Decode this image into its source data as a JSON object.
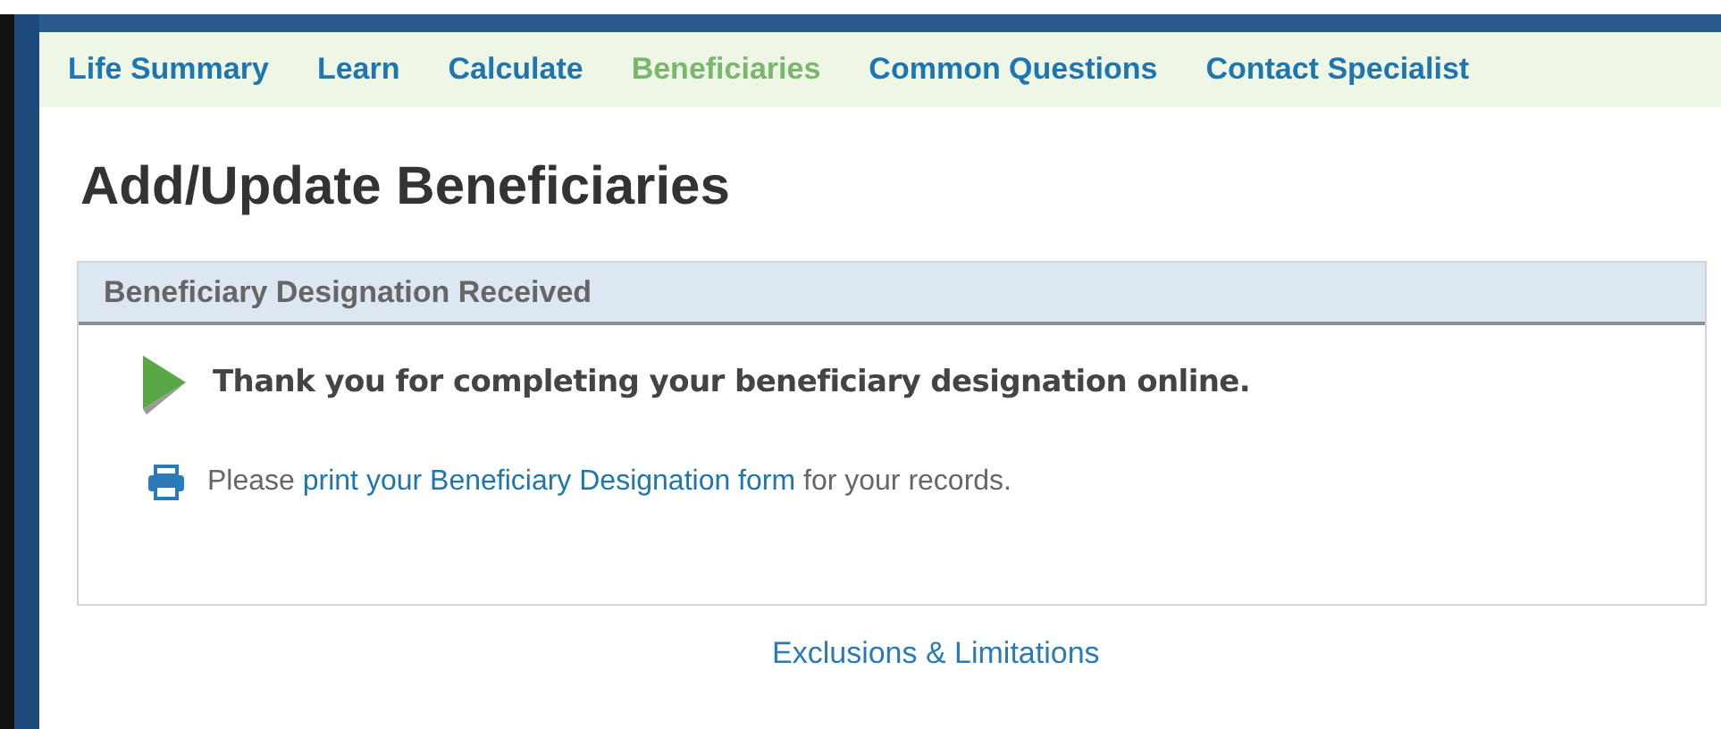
{
  "nav": [
    {
      "label": "Life Summary",
      "selected": false
    },
    {
      "label": "Learn",
      "selected": false
    },
    {
      "label": "Calculate",
      "selected": false
    },
    {
      "label": "Beneficiaries",
      "selected": true
    },
    {
      "label": "Common Questions",
      "selected": false
    },
    {
      "label": "Contact Specialist",
      "selected": false
    }
  ],
  "heading": "Add/Update Beneficiaries",
  "panel": {
    "title": "Beneficiary Designation Received",
    "confirmation": "Thank you for completing your beneficiary designation online.",
    "print_message": {
      "before": "Please",
      "link": "print your Beneficiary Designation form",
      "after": "for your records."
    }
  },
  "footer_link": "Exclusions & Limitations"
}
